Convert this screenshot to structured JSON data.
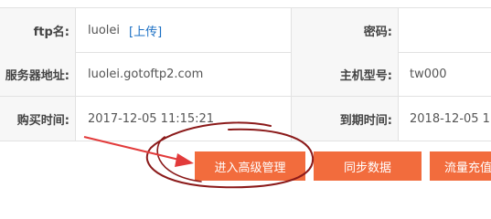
{
  "rows": [
    {
      "label_left": "ftp名:",
      "value_left": "luolei",
      "upload_link": "[上传]",
      "label_right": "密码:",
      "password_value": ""
    },
    {
      "label_left": "服务器地址:",
      "value_left": "luolei.gotoftp2.com",
      "label_right": "主机型号:",
      "value_right": "tw000"
    },
    {
      "label_left": "购买时间:",
      "value_left": "2017-12-05 11:15:21",
      "label_right": "到期时间:",
      "value_right": "2018-12-05 11"
    }
  ],
  "actions": {
    "advanced_manage": "进入高级管理",
    "sync_data": "同步数据",
    "recharge": "流量充值"
  },
  "colors": {
    "button": "#f26c3d",
    "annotation": "#8b1a1a",
    "arrow": "#e23b3b",
    "link": "#1a6fc4"
  }
}
